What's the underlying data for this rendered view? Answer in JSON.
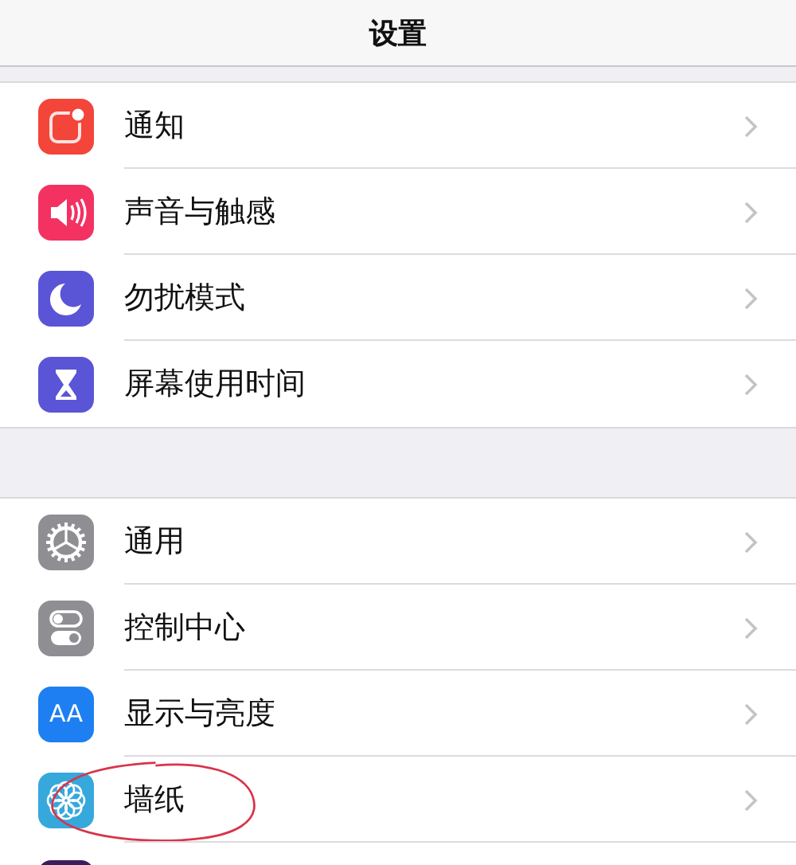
{
  "title": "设置",
  "groups": [
    {
      "items": [
        {
          "kind": "notification",
          "label": "通知",
          "circled": false
        },
        {
          "kind": "sound",
          "label": "声音与触感",
          "circled": false
        },
        {
          "kind": "moon",
          "label": "勿扰模式",
          "circled": false
        },
        {
          "kind": "hourglass",
          "label": "屏幕使用时间",
          "circled": false
        }
      ]
    },
    {
      "items": [
        {
          "kind": "gear",
          "label": "通用",
          "circled": false
        },
        {
          "kind": "toggles",
          "label": "控制中心",
          "circled": false
        },
        {
          "kind": "text",
          "glyph": "AA",
          "label": "显示与亮度",
          "circled": false
        },
        {
          "kind": "flower",
          "label": "墙纸",
          "circled": true
        },
        {
          "kind": "partial"
        }
      ]
    }
  ]
}
